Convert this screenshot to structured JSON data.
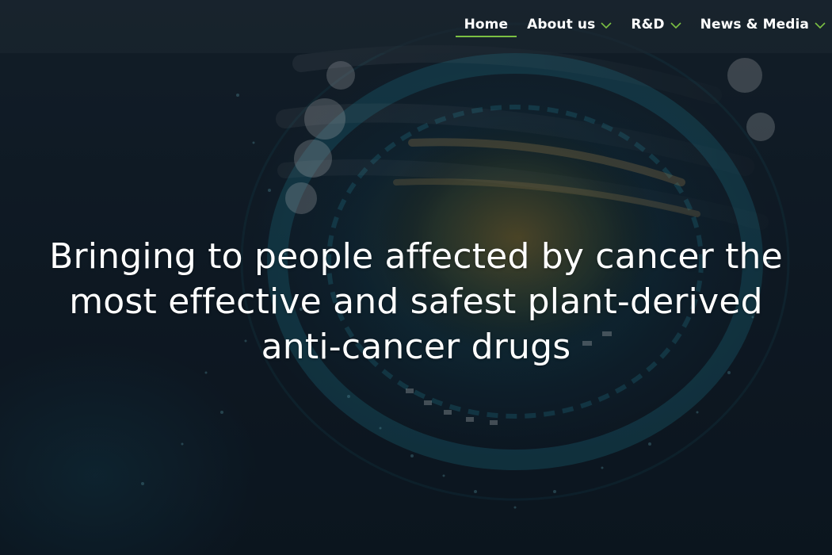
{
  "nav": {
    "items": [
      {
        "label": "Home",
        "active": true,
        "has_dropdown": false
      },
      {
        "label": "About us",
        "active": false,
        "has_dropdown": true
      },
      {
        "label": "R&D",
        "active": false,
        "has_dropdown": true
      },
      {
        "label": "News & Media",
        "active": false,
        "has_dropdown": true
      }
    ],
    "active_color": "#7bc043",
    "chevron_color": "#7bc043",
    "chevron_icon": "chevron-down-icon"
  },
  "hero": {
    "headline_lines": [
      "Bringing to people affected by cancer the",
      "most effective and safest plant-derived",
      "anti-cancer drugs"
    ],
    "background_colors": {
      "base": "#101c27",
      "teal_glow": "#14788c",
      "gold_glow": "#785a1e"
    }
  }
}
